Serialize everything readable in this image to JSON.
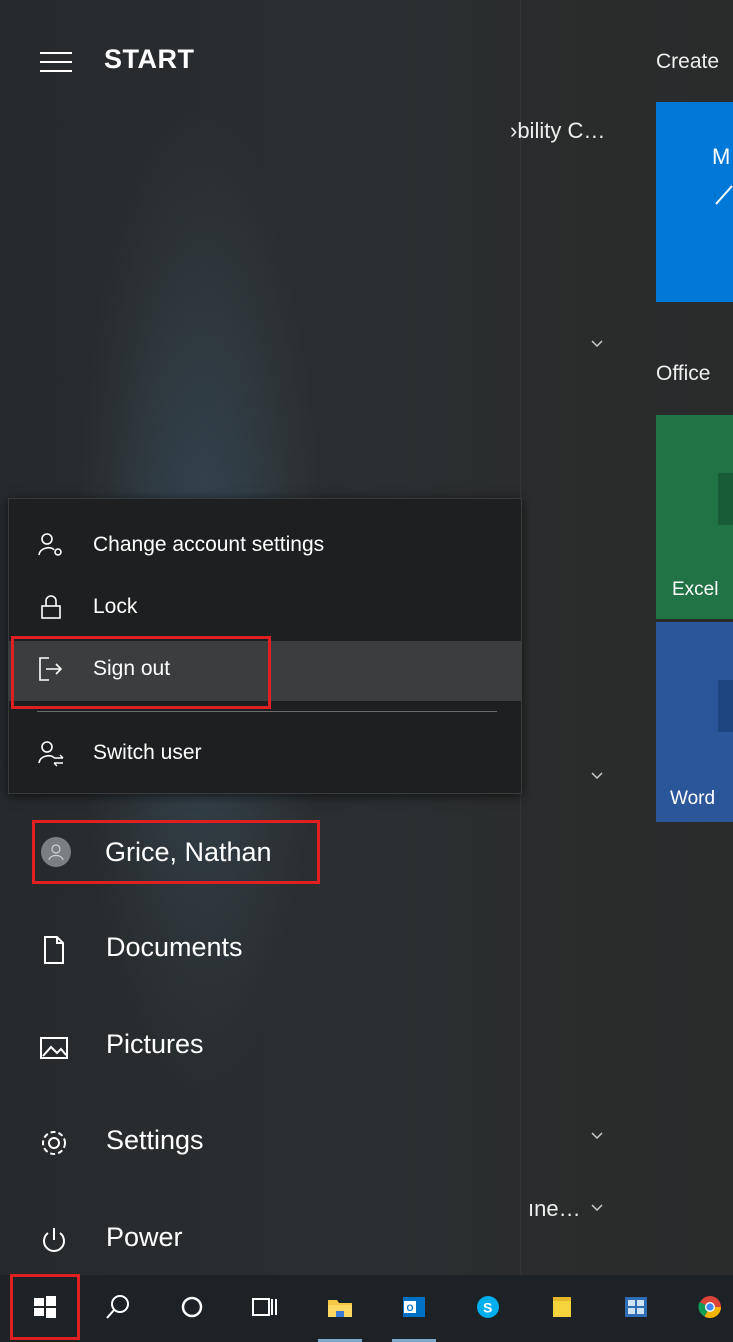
{
  "start": {
    "title": "START",
    "app_peeks": [
      {
        "text": "›bility C…"
      },
      {
        "text": "ıne…"
      }
    ]
  },
  "tiles": {
    "groups": [
      {
        "label": "Create"
      },
      {
        "label": "Office"
      }
    ],
    "create_tile": {
      "text": "M",
      "color": "#0078d7"
    },
    "excel": {
      "label": "Excel",
      "color": "#217346"
    },
    "word": {
      "label": "Word",
      "color": "#2b579a"
    }
  },
  "account_menu": {
    "items": [
      {
        "label": "Change account settings",
        "icon": "account-settings-icon"
      },
      {
        "label": "Lock",
        "icon": "lock-icon"
      },
      {
        "label": "Sign out",
        "icon": "sign-out-icon"
      },
      {
        "label": "Switch user",
        "icon": "switch-user-icon"
      }
    ]
  },
  "nav": {
    "user": {
      "name": "Grice, Nathan"
    },
    "items": [
      {
        "label": "Documents",
        "icon": "document-icon"
      },
      {
        "label": "Pictures",
        "icon": "pictures-icon"
      },
      {
        "label": "Settings",
        "icon": "gear-icon"
      },
      {
        "label": "Power",
        "icon": "power-icon"
      }
    ]
  },
  "taskbar": {
    "buttons": [
      {
        "name": "windows-start",
        "icon": "windows-logo-icon"
      },
      {
        "name": "search",
        "icon": "search-icon"
      },
      {
        "name": "cortana",
        "icon": "cortana-circle-icon"
      },
      {
        "name": "task-view",
        "icon": "task-view-icon"
      },
      {
        "name": "file-explorer",
        "icon": "folder-icon"
      },
      {
        "name": "outlook",
        "icon": "outlook-icon"
      },
      {
        "name": "skype",
        "icon": "skype-icon"
      },
      {
        "name": "sticky-notes",
        "icon": "sticky-notes-icon"
      },
      {
        "name": "control-panel",
        "icon": "control-panel-icon"
      },
      {
        "name": "chrome",
        "icon": "chrome-icon"
      }
    ]
  },
  "colors": {
    "highlight_red": "#e02020",
    "menu_bg": "#1e1f20",
    "taskbar_bg": "#1c2226"
  }
}
